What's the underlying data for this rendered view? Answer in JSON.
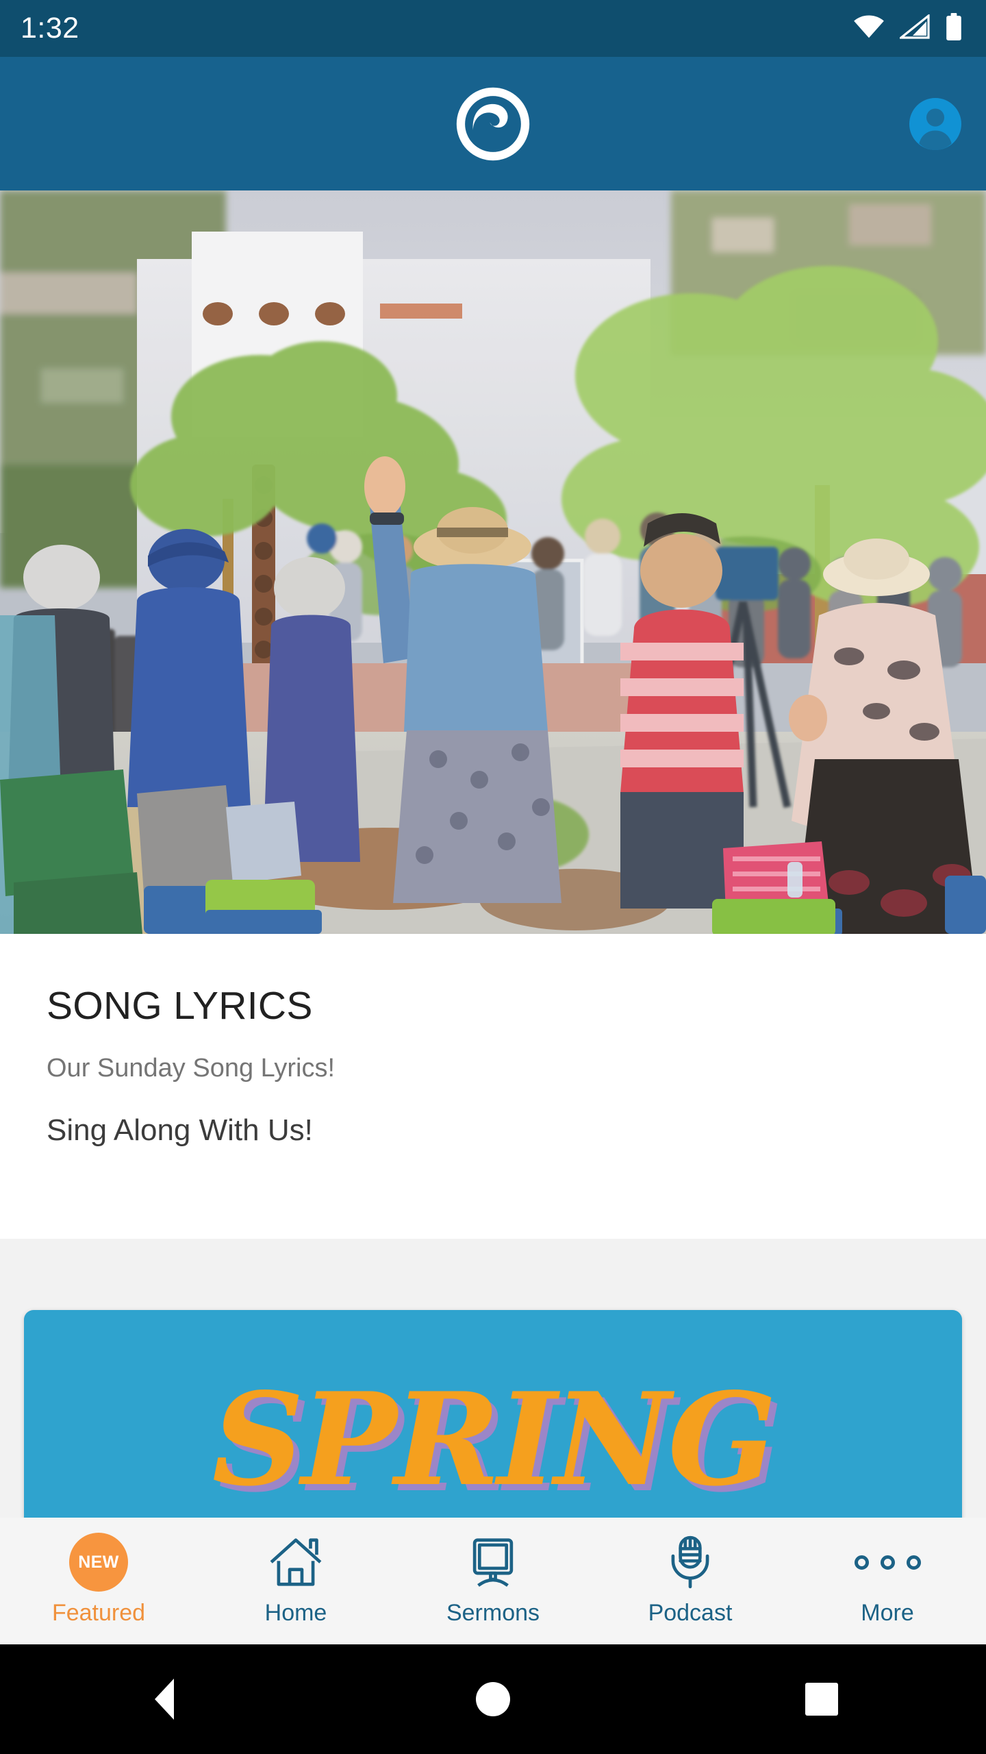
{
  "status_bar": {
    "time": "1:32",
    "icons": [
      "wifi-icon",
      "cellular-signal-icon",
      "battery-icon"
    ]
  },
  "header": {
    "logo_name": "wave-circle-logo",
    "avatar_name": "user-avatar-icon",
    "background_color": "#17628e"
  },
  "hero": {
    "alt": "Outdoor worship gathering with crowd, one woman raising her hand, trees and white building in background"
  },
  "content": {
    "title": "SONG LYRICS",
    "subtitle": "Our Sunday Song Lyrics!",
    "tagline": "Sing Along With Us!"
  },
  "promo": {
    "word": "SPRING",
    "card_color": "#2fa3ce",
    "text_color": "#f5a01e",
    "shadow_color": "#9b86c8"
  },
  "tab_bar": {
    "accent_color": "#f0913c",
    "inactive_color": "#1c6286",
    "items": [
      {
        "label": "Featured",
        "icon": "new-badge-icon",
        "badge": "NEW",
        "active": true
      },
      {
        "label": "Home",
        "icon": "house-icon",
        "active": false
      },
      {
        "label": "Sermons",
        "icon": "monitor-icon",
        "active": false
      },
      {
        "label": "Podcast",
        "icon": "microphone-icon",
        "active": false
      },
      {
        "label": "More",
        "icon": "three-dots-icon",
        "active": false
      }
    ]
  },
  "system_nav": {
    "back": "back-triangle-icon",
    "home": "home-circle-icon",
    "recents": "recents-square-icon"
  }
}
